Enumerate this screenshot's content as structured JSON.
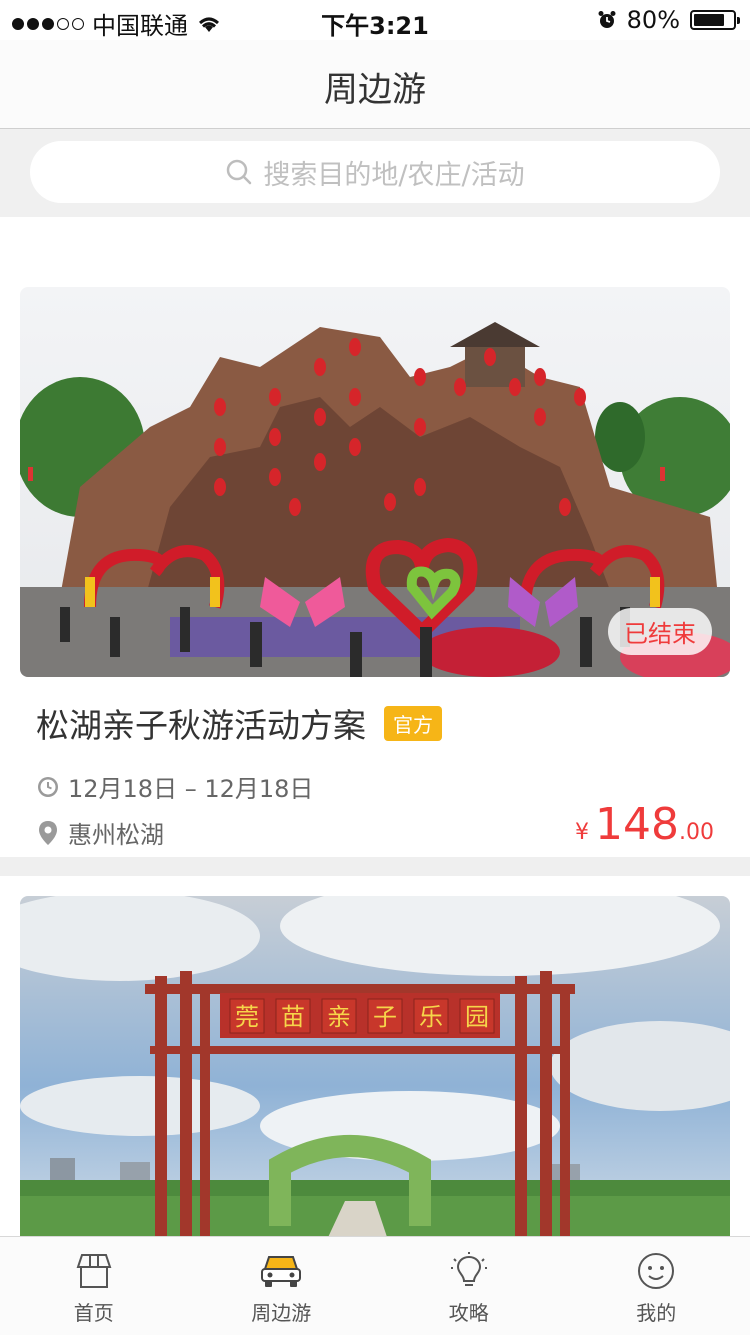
{
  "status_bar": {
    "carrier": "中国联通",
    "time": "下午3:21",
    "battery": "80%",
    "battery_level": 0.8,
    "signal_bars_filled": 3,
    "signal_bars_total": 5
  },
  "nav": {
    "title": "周边游"
  },
  "search": {
    "placeholder": "搜索目的地/农庄/活动"
  },
  "cards": [
    {
      "title": "松湖亲子秋游活动方案",
      "tag": "官方",
      "status": "已结束",
      "date_range": "12月18日 – 12月18日",
      "location": "惠州松湖",
      "price_currency": "¥",
      "price_int": "148",
      "price_dec": ".00"
    },
    {
      "sign_chars": [
        "莞",
        "苗",
        "亲",
        "子",
        "乐",
        "园"
      ]
    }
  ],
  "tabs": [
    {
      "label": "首页",
      "icon": "home-icon"
    },
    {
      "label": "周边游",
      "icon": "car-icon",
      "active": true
    },
    {
      "label": "攻略",
      "icon": "lightbulb-icon"
    },
    {
      "label": "我的",
      "icon": "smiley-icon"
    }
  ],
  "colors": {
    "accent_red": "#ef3b3b",
    "badge_yellow": "#f6b517",
    "active_tab_icon": "#f6b517"
  }
}
